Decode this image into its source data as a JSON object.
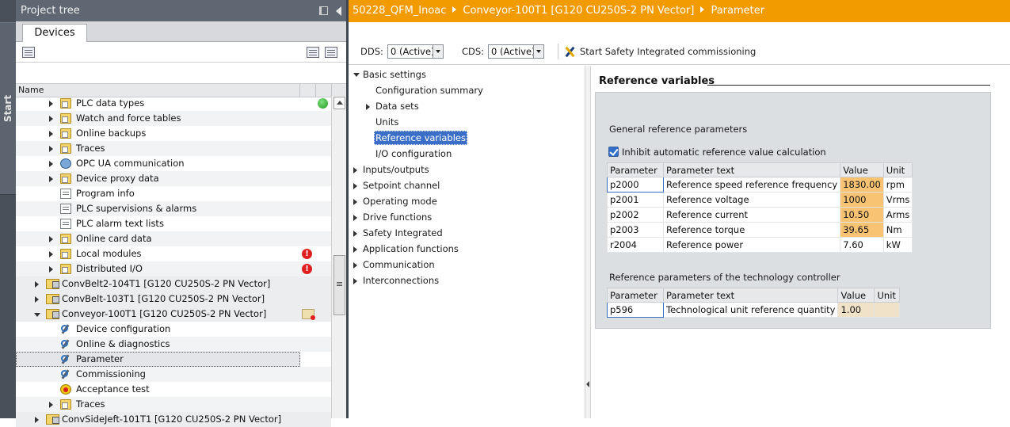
{
  "side": {
    "start_label": "Start"
  },
  "project_tree": {
    "title": "Project tree",
    "tab_devices": "Devices",
    "col_name": "Name",
    "items": [
      {
        "label": "PLC data types",
        "icon": "folder-icon",
        "status": "ok"
      },
      {
        "label": "Watch and force tables",
        "icon": "folder-icon"
      },
      {
        "label": "Online backups",
        "icon": "folder-icon"
      },
      {
        "label": "Traces",
        "icon": "folder-icon"
      },
      {
        "label": "OPC UA communication",
        "icon": "globe-icon"
      },
      {
        "label": "Device proxy data",
        "icon": "folder-icon"
      },
      {
        "label": "Program info",
        "icon": "doc-icon"
      },
      {
        "label": "PLC supervisions & alarms",
        "icon": "doc-icon"
      },
      {
        "label": "PLC alarm text lists",
        "icon": "doc-icon"
      },
      {
        "label": "Online card data",
        "icon": "folder-icon"
      },
      {
        "label": "Local modules",
        "icon": "folder-icon",
        "status": "error"
      },
      {
        "label": "Distributed I/O",
        "icon": "folder-icon",
        "status": "error"
      },
      {
        "label": "ConvBelt2-104T1 [G120 CU250S-2 PN Vector]",
        "icon": "device-folder-icon"
      },
      {
        "label": "ConvBelt-103T1 [G120 CU250S-2 PN Vector]",
        "icon": "device-folder-icon"
      },
      {
        "label": "Conveyor-100T1 [G120 CU250S-2 PN Vector]",
        "icon": "device-folder-icon",
        "status": "device-warning"
      },
      {
        "label": "Device configuration",
        "icon": "device-config-icon"
      },
      {
        "label": "Online & diagnostics",
        "icon": "diagnostics-icon"
      },
      {
        "label": "Parameter",
        "icon": "parameter-icon"
      },
      {
        "label": "Commissioning",
        "icon": "commissioning-icon"
      },
      {
        "label": "Acceptance test",
        "icon": "acceptance-test-icon"
      },
      {
        "label": "Traces",
        "icon": "folder-icon"
      },
      {
        "label": "ConvSideJeft-101T1 [G120 CU250S-2 PN Vector]",
        "icon": "device-folder-icon"
      }
    ]
  },
  "breadcrumb": {
    "items": [
      "50228_QFM_Inoac",
      "Conveyor-100T1 [G120 CU250S-2 PN Vector]",
      "Parameter"
    ]
  },
  "toolbar": {
    "dds_label": "DDS:",
    "dds_value": "0 (Active)",
    "cds_label": "CDS:",
    "cds_value": "0 (Active)",
    "safety_label": "Start Safety Integrated commissioning"
  },
  "nav": {
    "basic_settings": "Basic settings",
    "configuration_summary": "Configuration summary",
    "data_sets": "Data sets",
    "units": "Units",
    "reference_variables": "Reference variables",
    "io_configuration": "I/O configuration",
    "inputs_outputs": "Inputs/outputs",
    "setpoint_channel": "Setpoint channel",
    "operating_mode": "Operating mode",
    "drive_functions": "Drive functions",
    "safety_integrated": "Safety Integrated",
    "application_functions": "Application functions",
    "communication": "Communication",
    "interconnections": "Interconnections"
  },
  "content": {
    "title": "Reference variables",
    "general_section": "General reference parameters",
    "inhibit_label": "Inhibit automatic reference value calculation",
    "inhibit_checked": true,
    "table_headers": {
      "parameter": "Parameter",
      "text": "Parameter text",
      "value": "Value",
      "unit": "Unit"
    },
    "general_rows": [
      {
        "param": "p2000",
        "text": "Reference speed reference frequency",
        "value": "1830.00",
        "unit": "rpm"
      },
      {
        "param": "p2001",
        "text": "Reference voltage",
        "value": "1000",
        "unit": "Vrms"
      },
      {
        "param": "p2002",
        "text": "Reference current",
        "value": "10.50",
        "unit": "Arms"
      },
      {
        "param": "p2003",
        "text": "Reference torque",
        "value": "39.65",
        "unit": "Nm"
      },
      {
        "param": "r2004",
        "text": "Reference power",
        "value": "7.60",
        "unit": "kW"
      }
    ],
    "tech_section": "Reference parameters of the technology controller",
    "tech_rows": [
      {
        "param": "p596",
        "text": "Technological unit reference quantity",
        "value": "1.00",
        "unit": ""
      }
    ]
  },
  "colors": {
    "title_bar": "#f29b00",
    "selection": "#3b6fc7",
    "editable_value": "#f9c374"
  }
}
